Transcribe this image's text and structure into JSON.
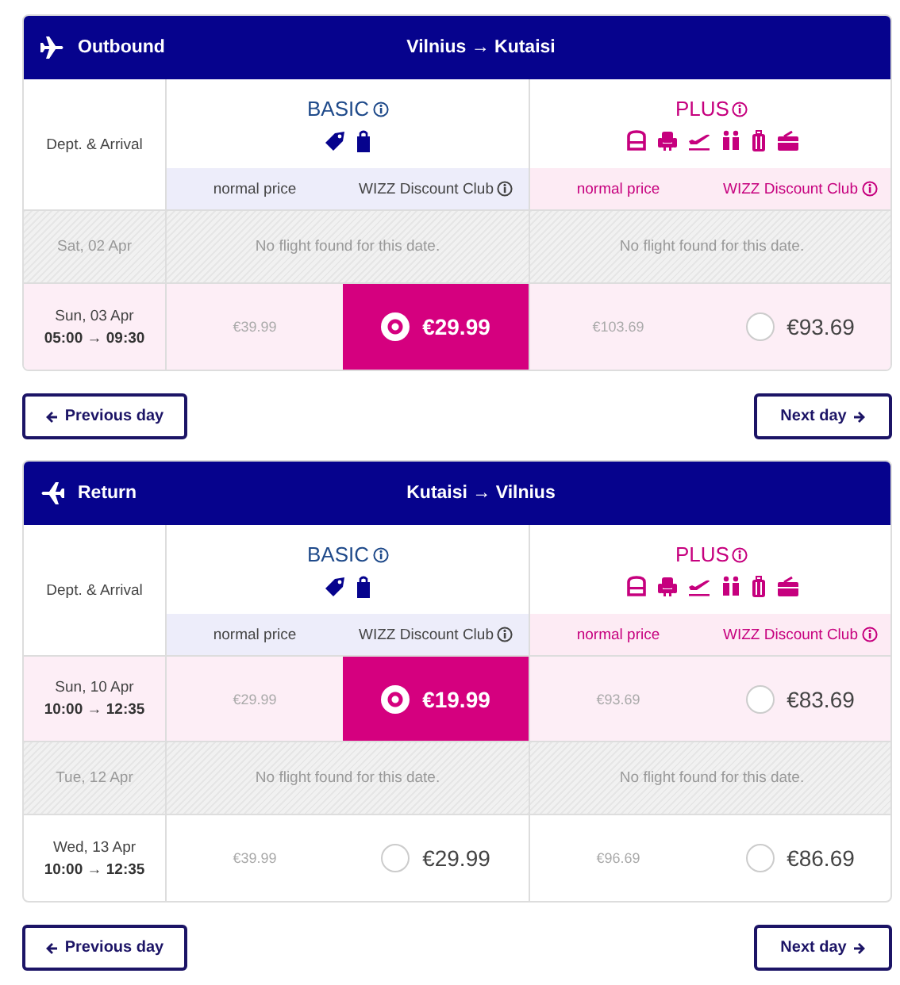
{
  "flights": [
    {
      "kind": "outbound",
      "title": "Outbound",
      "route": "Vilnius → Kutaisi",
      "date_header": "Dept. & Arrival",
      "fares": [
        {
          "kind": "basic",
          "name": "BASIC",
          "normal_label": "normal price",
          "club_label": "WIZZ Discount Club"
        },
        {
          "kind": "plus",
          "name": "PLUS",
          "normal_label": "normal price",
          "club_label": "WIZZ Discount Club"
        }
      ],
      "rows": [
        {
          "kind": "none",
          "date": "Sat, 02 Apr",
          "messages": [
            "No flight found for this date.",
            "No flight found for this date."
          ]
        },
        {
          "kind": "flight",
          "date": "Sun, 03 Apr",
          "times": "05:00 → 09:30",
          "prices": [
            {
              "normal": "€39.99",
              "club": "€29.99",
              "selected": true
            },
            {
              "normal": "€103.69",
              "club": "€93.69",
              "selected": false
            }
          ]
        }
      ],
      "buttons": {
        "previous": "Previous day",
        "next": "Next day"
      }
    },
    {
      "kind": "return",
      "title": "Return",
      "route": "Kutaisi → Vilnius",
      "date_header": "Dept. & Arrival",
      "fares": [
        {
          "kind": "basic",
          "name": "BASIC",
          "normal_label": "normal price",
          "club_label": "WIZZ Discount Club"
        },
        {
          "kind": "plus",
          "name": "PLUS",
          "normal_label": "normal price",
          "club_label": "WIZZ Discount Club"
        }
      ],
      "rows": [
        {
          "kind": "flight",
          "date": "Sun, 10 Apr",
          "times": "10:00 → 12:35",
          "prices": [
            {
              "normal": "€29.99",
              "club": "€19.99",
              "selected": true
            },
            {
              "normal": "€93.69",
              "club": "€83.69",
              "selected": false
            }
          ]
        },
        {
          "kind": "none",
          "date": "Tue, 12 Apr",
          "messages": [
            "No flight found for this date.",
            "No flight found for this date."
          ]
        },
        {
          "kind": "flight",
          "date": "Wed, 13 Apr",
          "times": "10:00 → 12:35",
          "prices": [
            {
              "normal": "€39.99",
              "club": "€29.99",
              "selected": false
            },
            {
              "normal": "€96.69",
              "club": "€86.69",
              "selected": false
            }
          ]
        }
      ],
      "buttons": {
        "previous": "Previous day",
        "next": "Next day"
      }
    }
  ]
}
